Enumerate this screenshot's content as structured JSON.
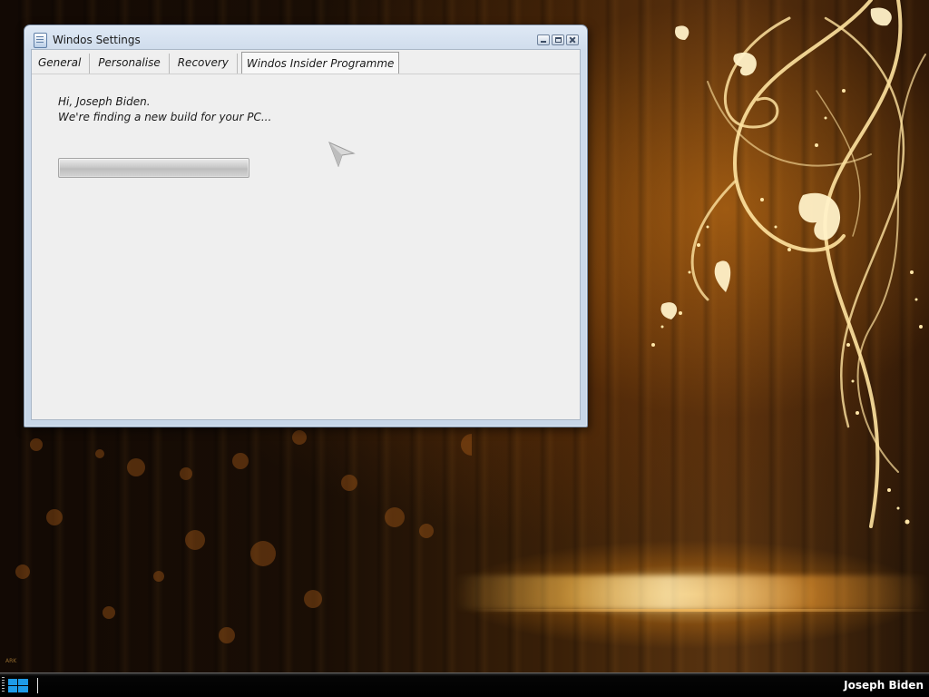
{
  "window": {
    "title": "Windos Settings",
    "tabs": [
      {
        "label": "General",
        "active": false
      },
      {
        "label": "Personalise",
        "active": false
      },
      {
        "label": "Recovery",
        "active": false
      },
      {
        "label": "Windos Insider Programme",
        "active": true
      }
    ],
    "greeting": "Hi, Joseph Biden.",
    "status": "We're finding a new build for your PC...",
    "progress": {
      "indeterminate": true
    }
  },
  "taskbar": {
    "start_icon": "windows-logo-icon",
    "user_name": "Joseph Biden"
  },
  "desktop": {
    "wallpaper_credit": "ARK"
  },
  "colors": {
    "taskbar_bg": "#000000",
    "window_frame": "#cfdcec",
    "client_bg": "#efefef",
    "wallpaper_glow": "#ffb43c",
    "start_logo": "#1e9be8"
  }
}
